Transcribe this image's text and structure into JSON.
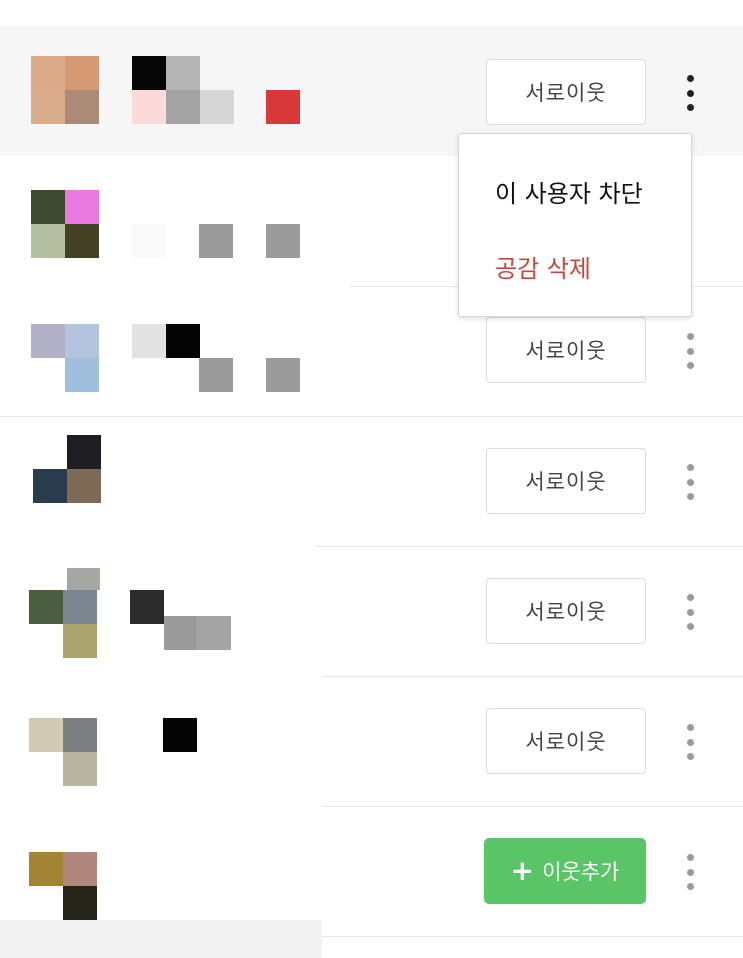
{
  "colors": {
    "row_highlight": "#f6f6f6",
    "add_button": "#5ac566",
    "delete_text": "#c9463e"
  },
  "rows": [
    {
      "button": "서로이웃"
    },
    {
      "button": ""
    },
    {
      "button": "서로이웃"
    },
    {
      "button": "서로이웃"
    },
    {
      "button": "서로이웃"
    },
    {
      "button": "서로이웃"
    },
    {
      "button": "이웃추가"
    }
  ],
  "menu": {
    "block_user": "이 사용자 차단",
    "delete_like": "공감 삭제"
  },
  "icons": {
    "kebab": "more-vertical-icon",
    "plus": "plus-icon"
  }
}
